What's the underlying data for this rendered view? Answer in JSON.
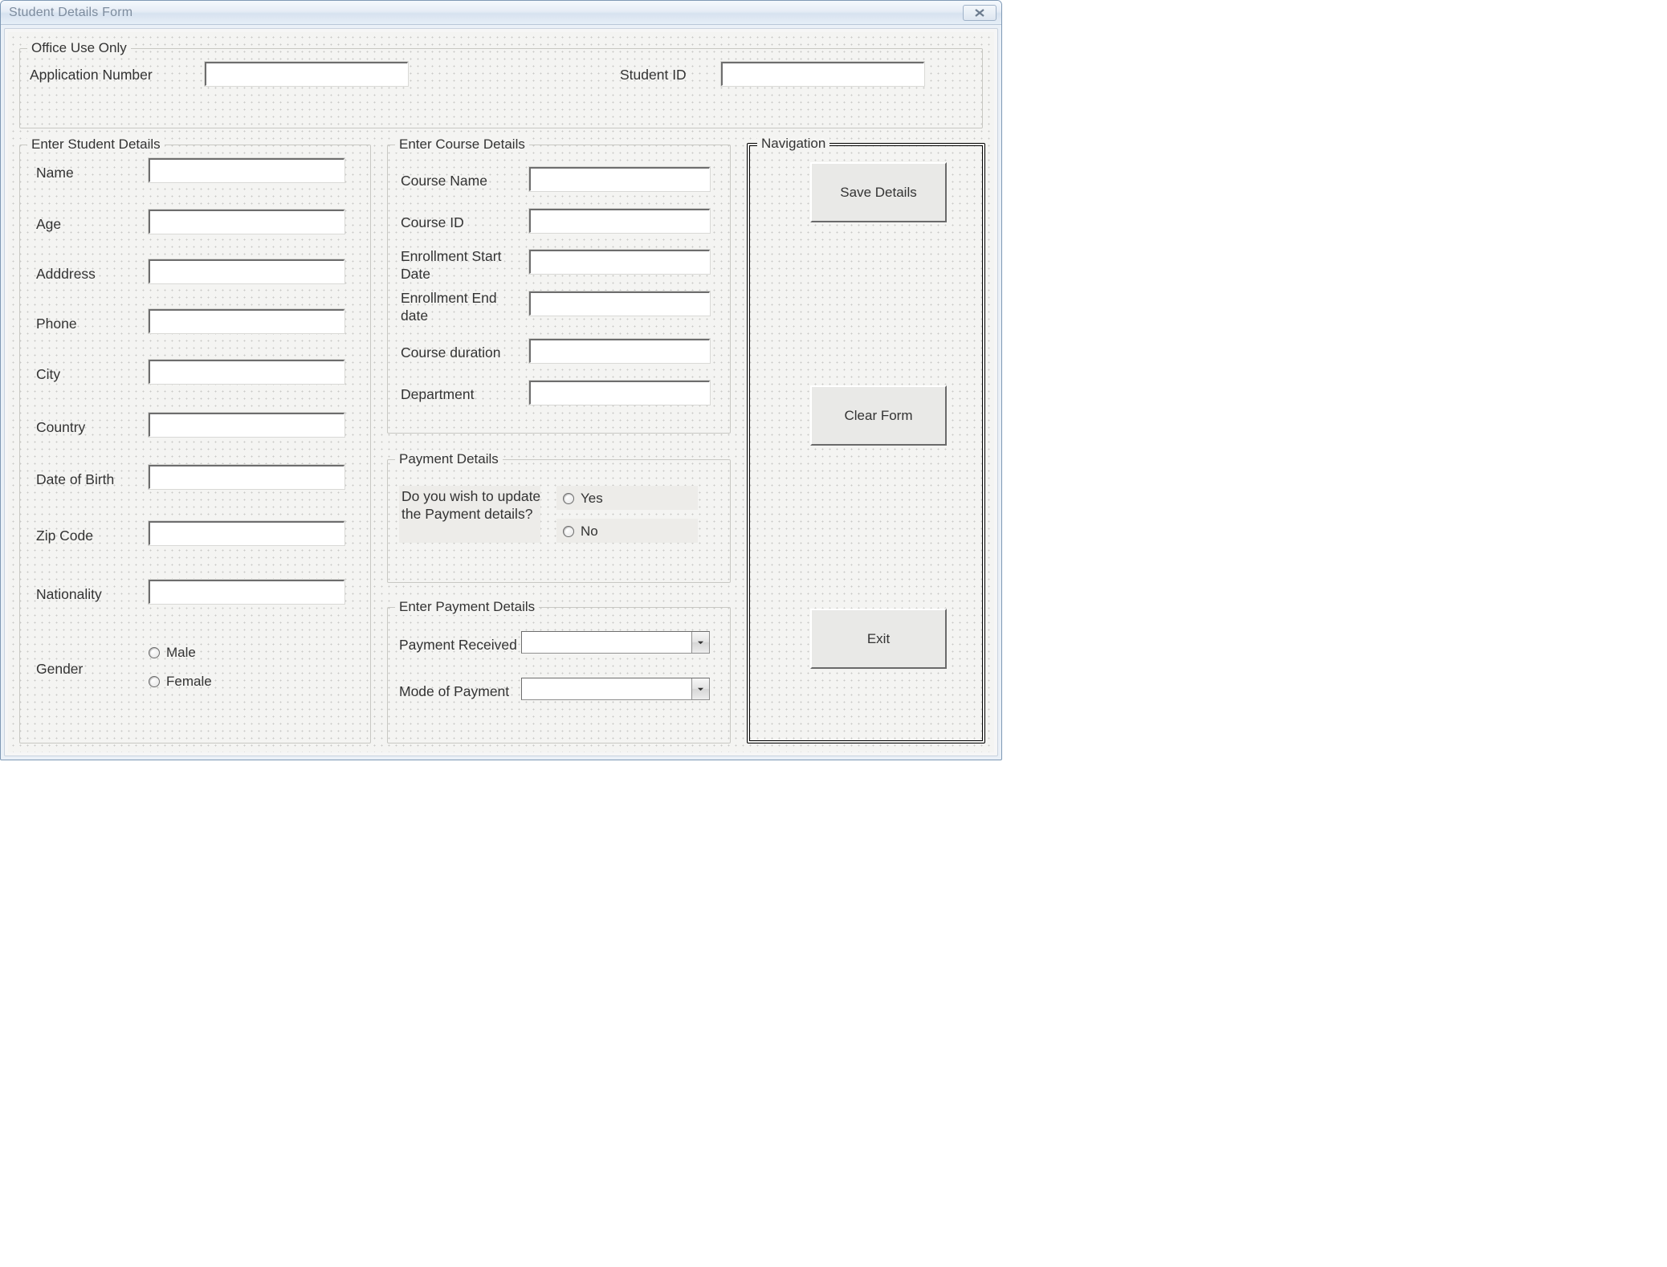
{
  "window": {
    "title": "Student Details Form"
  },
  "office": {
    "legend": "Office Use Only",
    "app_num_label": "Application Number",
    "student_id_label": "Student ID",
    "app_num_value": "",
    "student_id_value": ""
  },
  "student": {
    "legend": "Enter Student Details",
    "labels": {
      "name": "Name",
      "age": "Age",
      "address": "Adddress",
      "phone": "Phone",
      "city": "City",
      "country": "Country",
      "dob": "Date of Birth",
      "zip": "Zip Code",
      "nationality": "Nationality",
      "gender": "Gender"
    },
    "values": {
      "name": "",
      "age": "",
      "address": "",
      "phone": "",
      "city": "",
      "country": "",
      "dob": "",
      "zip": "",
      "nationality": ""
    },
    "gender_options": {
      "male": "Male",
      "female": "Female"
    }
  },
  "course": {
    "legend": "Enter Course Details",
    "labels": {
      "name": "Course Name",
      "id": "Course ID",
      "start": "Enrollment Start Date",
      "end": "Enrollment End date",
      "duration": "Course duration",
      "dept": "Department"
    },
    "values": {
      "name": "",
      "id": "",
      "start": "",
      "end": "",
      "duration": "",
      "dept": ""
    }
  },
  "payment_q": {
    "legend": "Payment Details",
    "question": "Do you wish to update the Payment details?",
    "yes": "Yes",
    "no": "No"
  },
  "payment": {
    "legend": "Enter Payment Details",
    "received_label": "Payment Received",
    "mode_label": "Mode of Payment",
    "received_value": "",
    "mode_value": ""
  },
  "nav": {
    "legend": "Navigation",
    "save": "Save Details",
    "clear": "Clear Form",
    "exit": "Exit"
  }
}
